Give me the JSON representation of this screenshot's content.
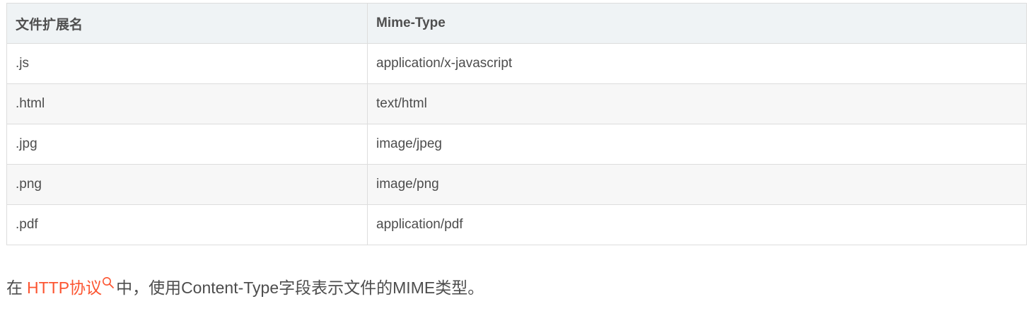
{
  "table": {
    "headers": [
      "文件扩展名",
      "Mime-Type"
    ],
    "rows": [
      [
        ".js",
        "application/x-javascript"
      ],
      [
        ".html",
        "text/html"
      ],
      [
        ".jpg",
        "image/jpeg"
      ],
      [
        ".png",
        "image/png"
      ],
      [
        ".pdf",
        "application/pdf"
      ]
    ]
  },
  "caption": {
    "prefix": "在",
    "link_text": "HTTP协议",
    "suffix": "中，使用Content-Type字段表示文件的MIME类型。",
    "link_icon": "search-icon"
  },
  "colors": {
    "link": "#fc5531",
    "text": "#4d4d4d",
    "header_bg": "#eff3f5",
    "row_alt_bg": "#f7f7f7",
    "border": "#dddddd"
  }
}
